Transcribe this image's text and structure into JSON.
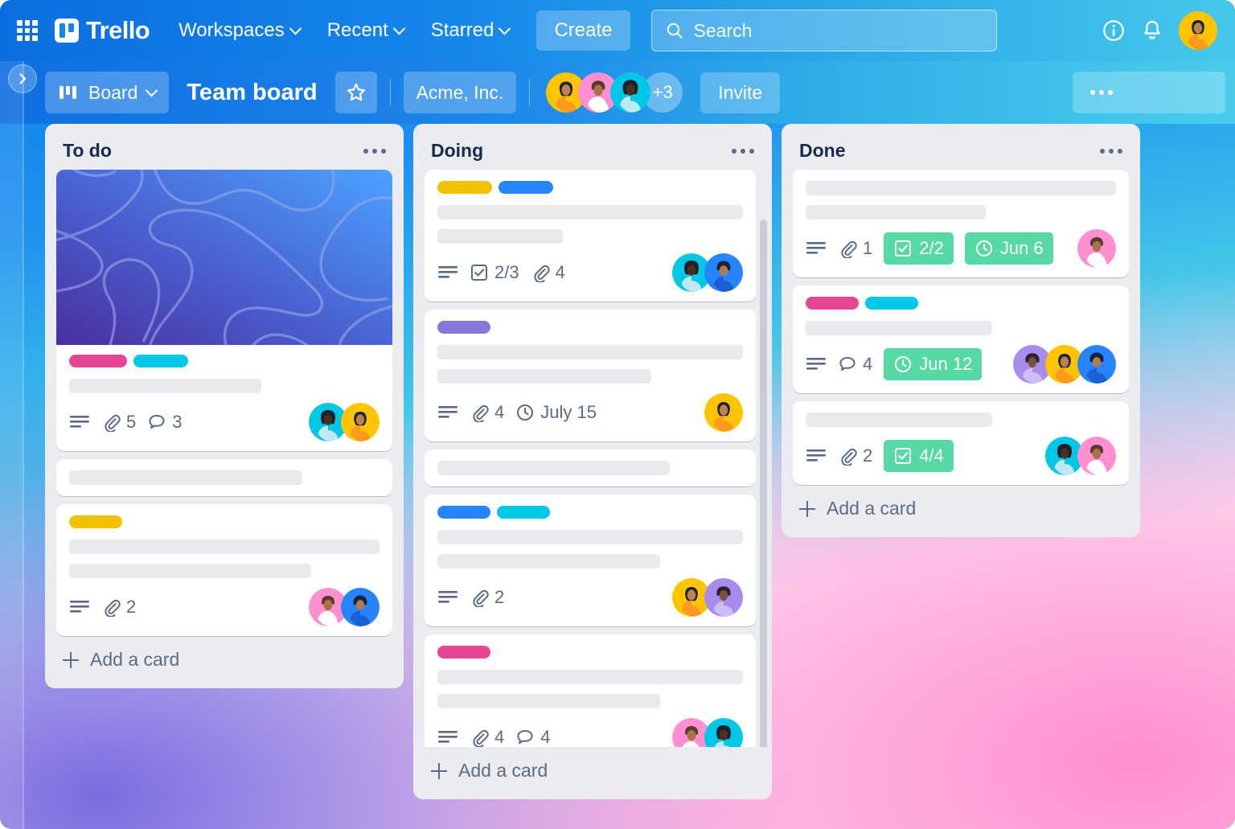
{
  "topnav": {
    "apps_icon": "apps-grid-icon",
    "brand": "Trello",
    "items": [
      {
        "label": "Workspaces",
        "icon": "chevron-down-icon"
      },
      {
        "label": "Recent",
        "icon": "chevron-down-icon"
      },
      {
        "label": "Starred",
        "icon": "chevron-down-icon"
      }
    ],
    "create_label": "Create",
    "search": {
      "placeholder": "Search",
      "value": "",
      "icon": "search-icon"
    },
    "info_icon": "info-icon",
    "bell_icon": "notifications-bell-icon",
    "account_avatar": "user-avatar"
  },
  "boardbar": {
    "sidebar_toggle_icon": "chevron-right-icon",
    "view_label": "Board",
    "view_icon": "board-view-icon",
    "view_chevron": "chevron-down-icon",
    "title": "Team board",
    "star_icon": "star-icon",
    "workspace": "Acme, Inc.",
    "members_extra": "+3",
    "invite_label": "Invite",
    "menu_icon": "more-options-icon"
  },
  "colors": {
    "label_pink": "#e74694",
    "label_cyan": "#00c7e6",
    "label_yellow": "#f2c200",
    "label_blue": "#2684ff",
    "label_purple": "#8777d9",
    "badge_green": "#57d9a3",
    "list_bg": "#ebecf0",
    "text_dark": "#172b4d",
    "text_muted": "#5b6b86"
  },
  "lists": [
    {
      "title": "To do",
      "menu_icon": "more-options-icon",
      "add_card_label": "Add a card",
      "scrollable": false,
      "cards": [
        {
          "cover": "blue-gradient-waves-cover",
          "labels": [
            "label_pink",
            "label_cyan"
          ],
          "skeleton_widths": [
            62
          ],
          "badges": [
            {
              "type": "description",
              "icon": "description-icon",
              "text": ""
            },
            {
              "type": "attachment",
              "icon": "attachment-icon",
              "text": "5"
            },
            {
              "type": "comment",
              "icon": "comment-icon",
              "text": "3"
            }
          ],
          "avatars": [
            "cyan-woman",
            "yellow-woman"
          ]
        },
        {
          "cover": null,
          "labels": [],
          "skeleton_widths": [
            75
          ],
          "badges": [],
          "avatars": []
        },
        {
          "cover": null,
          "labels": [
            "label_yellow"
          ],
          "skeleton_widths": [
            100,
            78
          ],
          "badges": [
            {
              "type": "description",
              "icon": "description-icon",
              "text": ""
            },
            {
              "type": "attachment",
              "icon": "attachment-icon",
              "text": "2"
            }
          ],
          "avatars": [
            "pink-man",
            "blue-man"
          ]
        }
      ]
    },
    {
      "title": "Doing",
      "menu_icon": "more-options-icon",
      "add_card_label": "Add a card",
      "scrollable": true,
      "cards": [
        {
          "cover": null,
          "labels": [
            "label_yellow",
            "label_blue"
          ],
          "skeleton_widths": [
            100,
            41
          ],
          "badges": [
            {
              "type": "description",
              "icon": "description-icon",
              "text": ""
            },
            {
              "type": "checklist",
              "icon": "checklist-icon",
              "text": "2/3"
            },
            {
              "type": "attachment",
              "icon": "attachment-icon",
              "text": "4"
            }
          ],
          "avatars": [
            "cyan-woman",
            "blue-man"
          ]
        },
        {
          "cover": null,
          "labels": [
            "label_purple"
          ],
          "skeleton_widths": [
            100,
            70
          ],
          "badges": [
            {
              "type": "description",
              "icon": "description-icon",
              "text": ""
            },
            {
              "type": "attachment",
              "icon": "attachment-icon",
              "text": "4"
            },
            {
              "type": "due-date",
              "icon": "clock-icon",
              "text": "July 15"
            }
          ],
          "avatars": [
            "yellow-woman"
          ]
        },
        {
          "cover": null,
          "labels": [],
          "skeleton_widths": [
            76
          ],
          "badges": [],
          "avatars": []
        },
        {
          "cover": null,
          "labels": [
            "label_blue",
            "label_cyan"
          ],
          "skeleton_widths": [
            100,
            73
          ],
          "badges": [
            {
              "type": "description",
              "icon": "description-icon",
              "text": ""
            },
            {
              "type": "attachment",
              "icon": "attachment-icon",
              "text": "2"
            }
          ],
          "avatars": [
            "yellow-woman",
            "purple-man"
          ]
        },
        {
          "cover": null,
          "labels": [
            "label_pink"
          ],
          "skeleton_widths": [
            100,
            73
          ],
          "badges": [
            {
              "type": "description",
              "icon": "description-icon",
              "text": ""
            },
            {
              "type": "attachment",
              "icon": "attachment-icon",
              "text": "4"
            },
            {
              "type": "comment",
              "icon": "comment-icon",
              "text": "4"
            }
          ],
          "avatars": [
            "pink-man",
            "cyan-woman"
          ]
        }
      ]
    },
    {
      "title": "Done",
      "menu_icon": "more-options-icon",
      "add_card_label": "Add a card",
      "scrollable": false,
      "cards": [
        {
          "cover": null,
          "labels": [],
          "skeleton_widths": [
            100,
            58
          ],
          "badges": [
            {
              "type": "description",
              "icon": "description-icon",
              "text": ""
            },
            {
              "type": "attachment",
              "icon": "attachment-icon",
              "text": "1"
            },
            {
              "type": "checklist",
              "icon": "checklist-icon",
              "text": "2/2",
              "green": true
            },
            {
              "type": "due-date",
              "icon": "clock-icon",
              "text": "Jun 6",
              "green": true
            }
          ],
          "avatars": [
            "pink-man"
          ]
        },
        {
          "cover": null,
          "labels": [
            "label_pink",
            "label_cyan"
          ],
          "skeleton_widths": [
            60
          ],
          "badges": [
            {
              "type": "description",
              "icon": "description-icon",
              "text": ""
            },
            {
              "type": "comment",
              "icon": "comment-icon",
              "text": "4"
            },
            {
              "type": "due-date",
              "icon": "clock-icon",
              "text": "Jun 12",
              "green": true
            }
          ],
          "avatars": [
            "purple-man",
            "yellow-woman",
            "blue-man"
          ]
        },
        {
          "cover": null,
          "labels": [],
          "skeleton_widths": [
            60
          ],
          "badges": [
            {
              "type": "description",
              "icon": "description-icon",
              "text": ""
            },
            {
              "type": "attachment",
              "icon": "attachment-icon",
              "text": "2"
            },
            {
              "type": "checklist",
              "icon": "checklist-icon",
              "text": "4/4",
              "green": true
            }
          ],
          "avatars": [
            "cyan-woman",
            "pink-man"
          ]
        }
      ]
    }
  ]
}
